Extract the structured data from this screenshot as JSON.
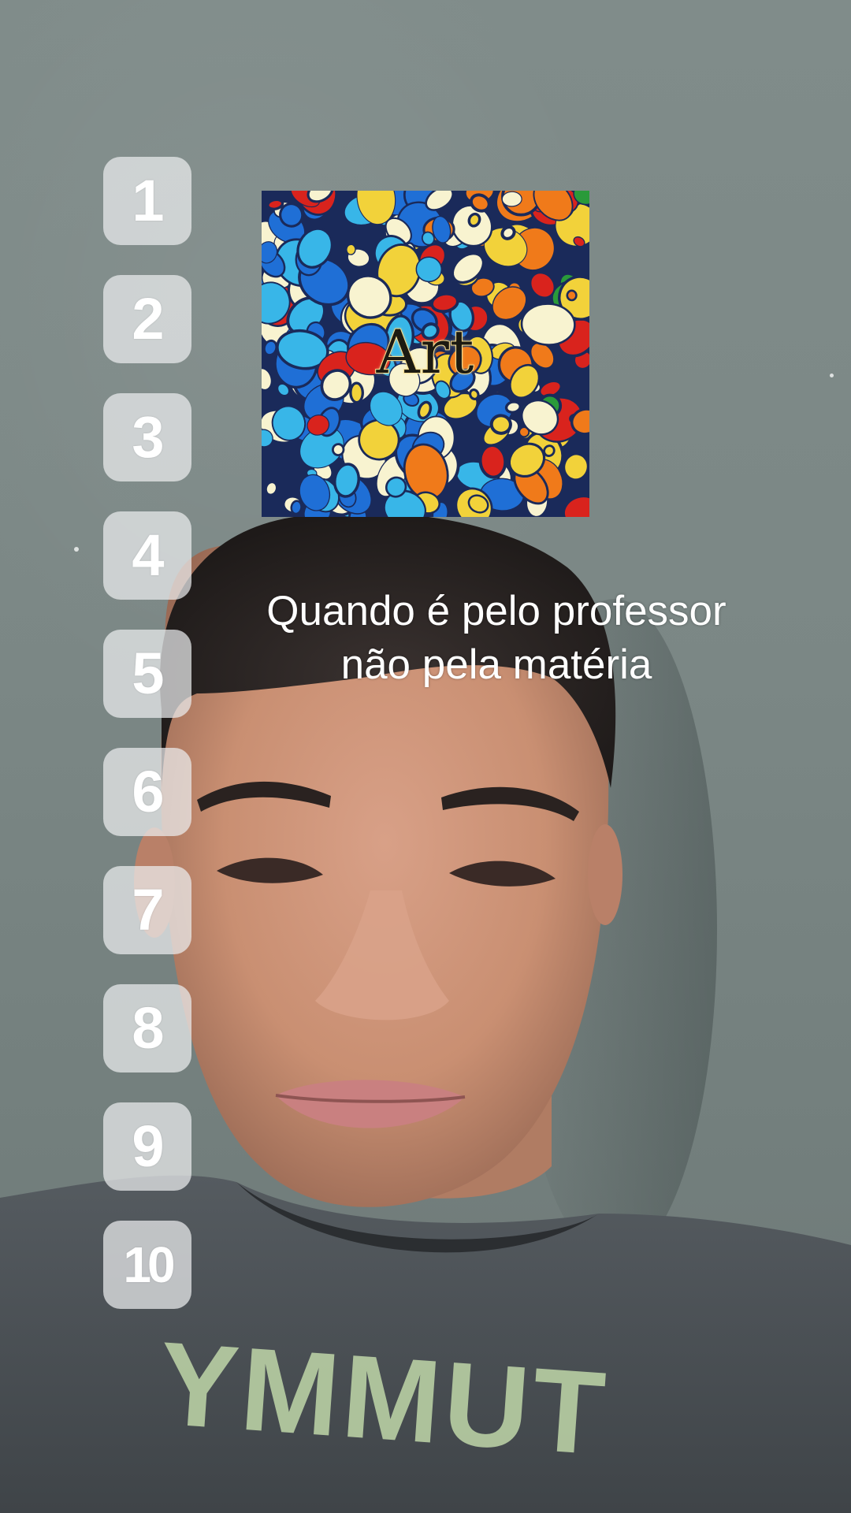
{
  "scene": {
    "description_colors": {
      "wall": "#7f8a89",
      "skin": "#c98f72",
      "hair": "#2a2422",
      "shirt": "#4a4f53",
      "shirt_print": "#b9cfa4"
    }
  },
  "ranking": {
    "items": [
      {
        "label": "1"
      },
      {
        "label": "2"
      },
      {
        "label": "3"
      },
      {
        "label": "4"
      },
      {
        "label": "5"
      },
      {
        "label": "6"
      },
      {
        "label": "7"
      },
      {
        "label": "8"
      },
      {
        "label": "9"
      },
      {
        "label": "10"
      }
    ]
  },
  "sticker": {
    "label": "Art",
    "palette": [
      "#1f6fd6",
      "#38b6e8",
      "#f2d23a",
      "#f07a1a",
      "#d9231d",
      "#2a9a3a",
      "#f8f3d0",
      "#1a2a5a"
    ]
  },
  "caption": {
    "line1": "Quando é pelo professor",
    "line2": "não pela matéria"
  },
  "shirt": {
    "print_text": "YMMUT"
  }
}
